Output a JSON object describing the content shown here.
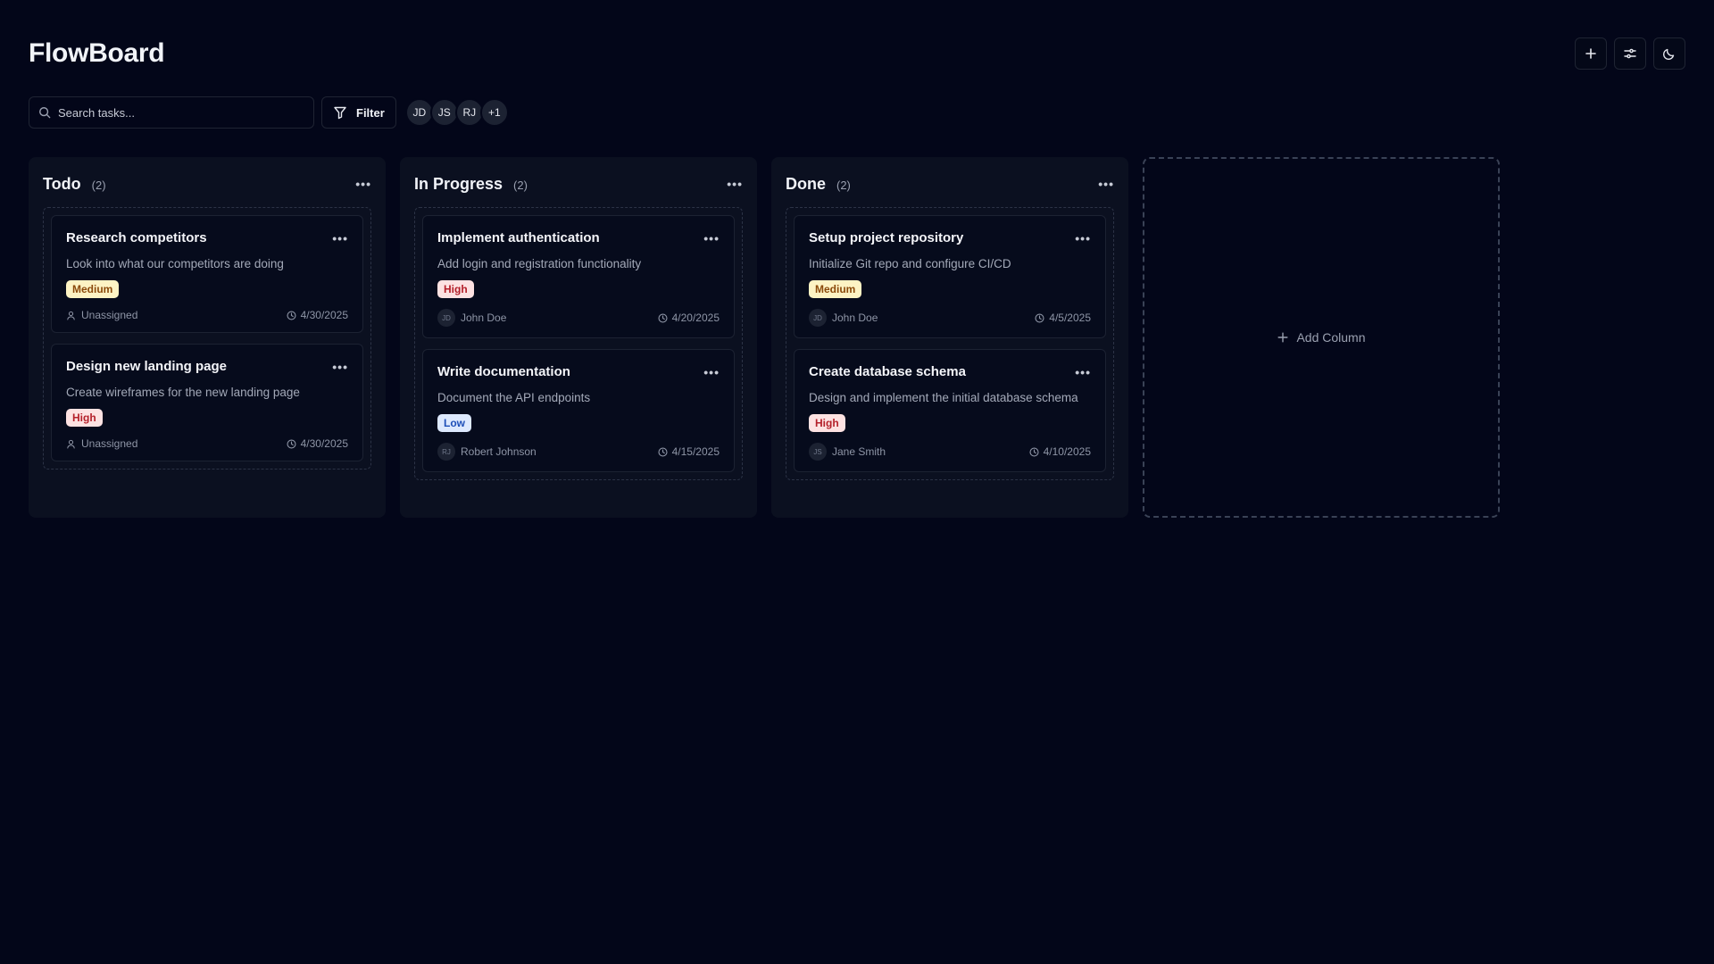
{
  "app": {
    "title": "FlowBoard"
  },
  "header_actions": [
    {
      "icon": "plus-icon",
      "label": "Add"
    },
    {
      "icon": "settings-sliders-icon",
      "label": "Settings"
    },
    {
      "icon": "moon-icon",
      "label": "Theme"
    }
  ],
  "search": {
    "placeholder": "Search tasks..."
  },
  "filter": {
    "label": "Filter"
  },
  "avatars": [
    "JD",
    "JS",
    "RJ",
    "+1"
  ],
  "columns": [
    {
      "name": "Todo",
      "count": "(2)",
      "cards": [
        {
          "title": "Research competitors",
          "description": "Look into what our competitors are doing",
          "priority": "Medium",
          "assignee": "Unassigned",
          "assignee_initials": "",
          "due": "4/30/2025"
        },
        {
          "title": "Design new landing page",
          "description": "Create wireframes for the new landing page",
          "priority": "High",
          "assignee": "Unassigned",
          "assignee_initials": "",
          "due": "4/30/2025"
        }
      ]
    },
    {
      "name": "In Progress",
      "count": "(2)",
      "cards": [
        {
          "title": "Implement authentication",
          "description": "Add login and registration functionality",
          "priority": "High",
          "assignee": "John Doe",
          "assignee_initials": "JD",
          "due": "4/20/2025"
        },
        {
          "title": "Write documentation",
          "description": "Document the API endpoints",
          "priority": "Low",
          "assignee": "Robert Johnson",
          "assignee_initials": "RJ",
          "due": "4/15/2025"
        }
      ]
    },
    {
      "name": "Done",
      "count": "(2)",
      "cards": [
        {
          "title": "Setup project repository",
          "description": "Initialize Git repo and configure CI/CD",
          "priority": "Medium",
          "assignee": "John Doe",
          "assignee_initials": "JD",
          "due": "4/5/2025"
        },
        {
          "title": "Create database schema",
          "description": "Design and implement the initial database schema",
          "priority": "High",
          "assignee": "Jane Smith",
          "assignee_initials": "JS",
          "due": "4/10/2025"
        }
      ]
    }
  ],
  "add_column": {
    "label": "Add Column"
  },
  "colors": {
    "background": "#030619",
    "column": "#0b1020",
    "card": "#060b1c",
    "medium": "#fdf3c4",
    "high": "#fde2e2",
    "low": "#dde9fe"
  }
}
